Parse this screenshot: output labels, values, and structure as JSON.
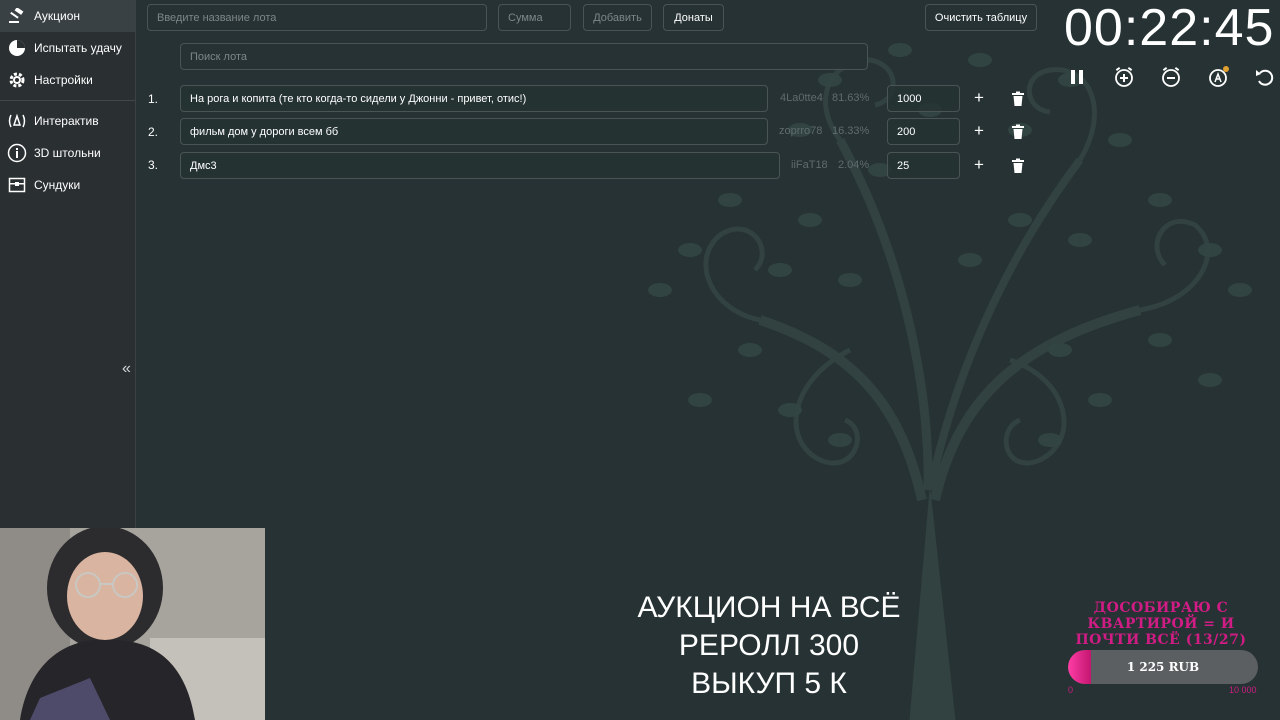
{
  "sidebar": {
    "items": [
      {
        "label": "Аукцион",
        "icon": "gavel-icon"
      },
      {
        "label": "Испытать удачу",
        "icon": "pie-chart-icon"
      },
      {
        "label": "Настройки",
        "icon": "gear-icon"
      },
      {
        "label": "Интерактив",
        "icon": "campfire-icon"
      },
      {
        "label": "3D штольни",
        "icon": "info-circle-icon"
      },
      {
        "label": "Сундуки",
        "icon": "chest-icon"
      }
    ],
    "collapse_label": "«"
  },
  "toolbar": {
    "lot_name_placeholder": "Введите название лота",
    "amount_placeholder": "Сумма",
    "add_label": "Добавить",
    "donations_label": "Донаты",
    "clear_label": "Очистить таблицу",
    "search_placeholder": "Поиск лота"
  },
  "timer": {
    "value": "00:22:45",
    "controls": [
      "pause-icon",
      "add-time-icon",
      "subtract-time-icon",
      "auto-time-icon",
      "reset-icon"
    ]
  },
  "lots": [
    {
      "num": "1.",
      "name": "На рога и копита (те кто когда-то сидели у Джонни - привет, отис!)",
      "user": "4La0tte4",
      "percent": "81.63%",
      "amount": "1000"
    },
    {
      "num": "2.",
      "name": "фильм дом у дороги всем бб",
      "user": "zoprro78",
      "percent": "16.33%",
      "amount": "200"
    },
    {
      "num": "3.",
      "name": "Дмс3",
      "user": "iiFaT18",
      "percent": "2.04%",
      "amount": "25"
    }
  ],
  "lot_actions": {
    "plus_label": "+"
  },
  "overlay": {
    "line1": "АУКЦИОН НА ВСЁ",
    "line2": "РЕРОЛЛ 300",
    "line3": "ВЫКУП 5 К"
  },
  "goal": {
    "title": "ДОСОБИРАЮ С КВАРТИРОЙ = И ПОЧТИ ВСЁ (13/27)",
    "current_label": "1 225 RUB",
    "min": "0",
    "max": "10 000",
    "progress": 0.1225,
    "color": "#d01c84"
  },
  "colors": {
    "background": "#263233",
    "sidebar": "#2a2f31",
    "border": "#4a5456"
  }
}
